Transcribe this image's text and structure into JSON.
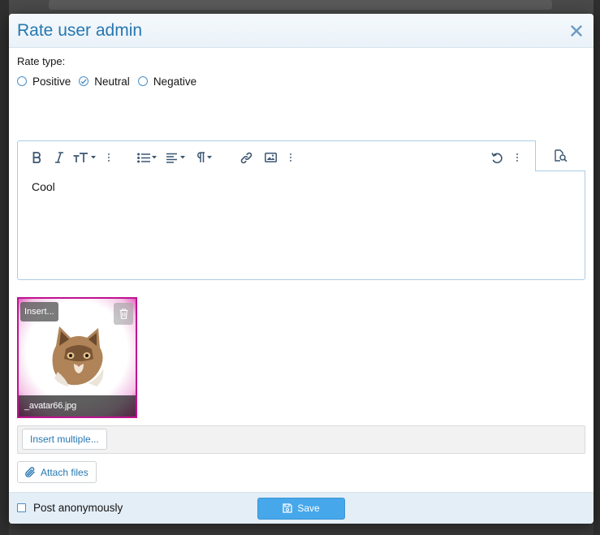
{
  "dialog": {
    "title": "Rate user admin",
    "close_icon": "close-icon"
  },
  "rate": {
    "label": "Rate type:",
    "options": [
      {
        "label": "Positive",
        "checked": false
      },
      {
        "label": "Neutral",
        "checked": true
      },
      {
        "label": "Negative",
        "checked": false
      }
    ]
  },
  "editor": {
    "toolbar_icons": [
      "bold-icon",
      "italic-icon",
      "text-size-icon",
      "more-text-icon",
      "list-icon",
      "align-icon",
      "paragraph-icon",
      "link-icon",
      "image-icon",
      "more-insert-icon",
      "undo-icon",
      "more-options-icon",
      "preview-icon"
    ],
    "content": "Cool"
  },
  "attachment": {
    "insert_label": "Insert...",
    "filename": "_avatar66.jpg"
  },
  "insert_multiple_label": "Insert multiple...",
  "attach_files_label": "Attach files",
  "post_anonymously_label": "Post anonymously",
  "save_label": "Save",
  "colors": {
    "accent": "#2577b1",
    "save_button": "#47a7eb",
    "thumb_border": "#c0128f"
  }
}
